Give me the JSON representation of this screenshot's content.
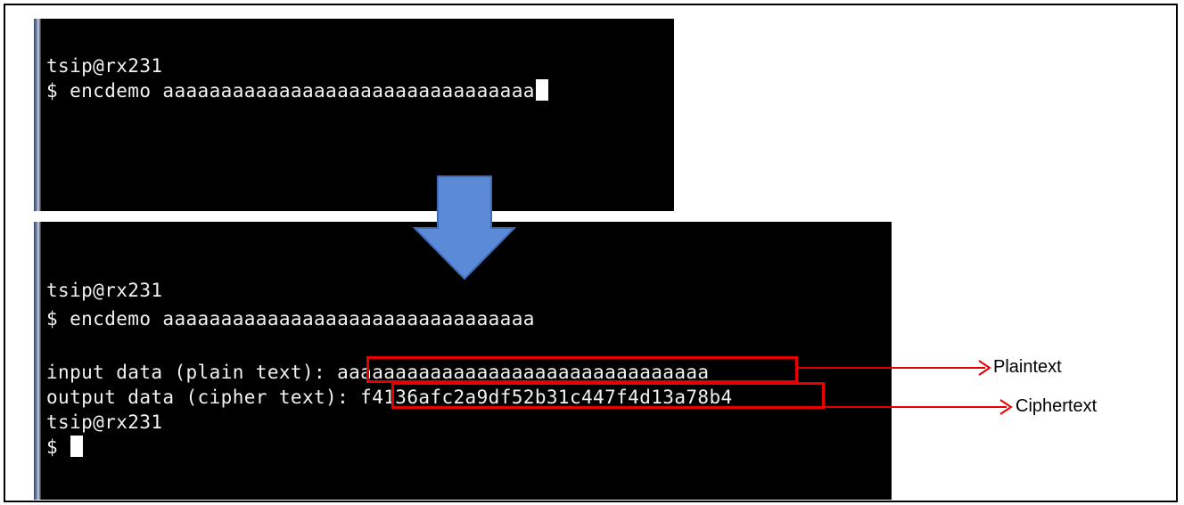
{
  "colors": {
    "terminal_bg": "#000000",
    "terminal_text": "#ffffff",
    "highlight": "#e60000",
    "flow_arrow": "#5b8ad6"
  },
  "terminal_before": {
    "line1": "tsip@rx231",
    "line2": "$ encdemo aaaaaaaaaaaaaaaaaaaaaaaaaaaaaaaa"
  },
  "terminal_after": {
    "line1": "tsip@rx231",
    "line2": "$ encdemo aaaaaaaaaaaaaaaaaaaaaaaaaaaaaaaa",
    "input_prefix": "input data (plain text): ",
    "input_value": "aaaaaaaaaaaaaaaaaaaaaaaaaaaaaaaa",
    "output_prefix": "output data (cipher text): ",
    "output_value": "f4136afc2a9df52b31c447f4d13a78b4",
    "line5": "tsip@rx231",
    "line6": "$ "
  },
  "annotations": {
    "plaintext_label": "Plaintext",
    "ciphertext_label": "Ciphertext"
  },
  "icons": {
    "flow": "down-arrow-icon",
    "pointer": "right-arrow-icon"
  }
}
